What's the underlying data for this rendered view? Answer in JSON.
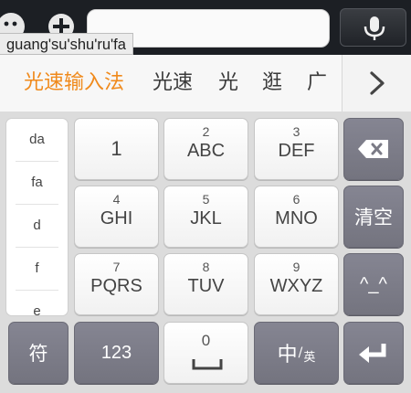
{
  "top_bar": {
    "icons": [
      "emoji-icon",
      "plus-icon",
      "microphone-icon"
    ],
    "input_value": ""
  },
  "composing": {
    "pinyin": "guang'su'shu'ru'fa"
  },
  "candidates": {
    "items": [
      "光速输入法",
      "光速",
      "光",
      "逛",
      "广"
    ],
    "highlight_color": "#f08a1c",
    "more_icon": "chevron-right-icon"
  },
  "pinyin_options": [
    "da",
    "fa",
    "d",
    "f",
    "e"
  ],
  "keys": {
    "k1": {
      "label": "1"
    },
    "k2": {
      "digit": "2",
      "letters": "ABC"
    },
    "k3": {
      "digit": "3",
      "letters": "DEF"
    },
    "k4": {
      "digit": "4",
      "letters": "GHI"
    },
    "k5": {
      "digit": "5",
      "letters": "JKL"
    },
    "k6": {
      "digit": "6",
      "letters": "MNO"
    },
    "k7": {
      "digit": "7",
      "letters": "PQRS"
    },
    "k8": {
      "digit": "8",
      "letters": "TUV"
    },
    "k9": {
      "digit": "9",
      "letters": "WXYZ"
    },
    "backspace_icon": "backspace-icon",
    "clear": "清空",
    "emoticon": "^_^",
    "symbol": "符",
    "numeric": "123",
    "space_digit": "0",
    "lang_main": "中",
    "lang_sep": "/",
    "lang_alt": "英",
    "enter_icon": "enter-icon"
  },
  "colors": {
    "top_bar": "#1c1f24",
    "function_key": "#7b7b86",
    "light_key": "#ffffff"
  }
}
